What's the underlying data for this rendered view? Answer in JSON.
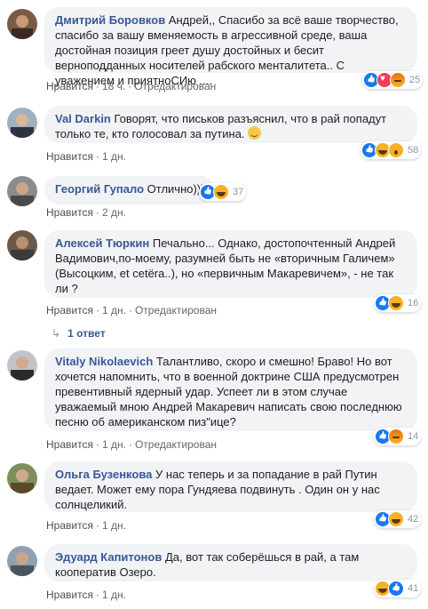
{
  "comments": [
    {
      "author": "Дмитрий Боровков",
      "text": "Андрей,, Спасибо за всё ваше творчество, спасибо за вашу вменяемость в агрессивной среде, ваша достойная позиция греет душу достойных и бесит верноподданных носителей рабского менталитета.. С уважением и приятноСИю ....",
      "like": "Нравится",
      "time": "18 ч.",
      "edited": "Отредактирован",
      "reactions": [
        "like",
        "love",
        "angry"
      ],
      "count": "25"
    },
    {
      "author": "Val Darkin",
      "text": "Говорят, что письков разъяснил, что в рай попадут только те, кто голосовал за путина.",
      "like": "Нравится",
      "time": "1 дн.",
      "edited": "",
      "reactions": [
        "like",
        "haha",
        "wow"
      ],
      "count": "58"
    },
    {
      "author": "Георгий Гупало",
      "text": "Отлично)))",
      "like": "Нравится",
      "time": "2 дн.",
      "edited": "",
      "reactions": [
        "like",
        "haha"
      ],
      "count": "37"
    },
    {
      "author": "Алексей Тюркин",
      "text": "Печально... Однако, достопочтенный Андрей Вадимович,по-моему, разумней быть не «вторичным Галичем» (Высоцким, et cetëra..), но «первичным Макаревичем», - не так ли ?",
      "like": "Нравится",
      "time": "1 дн.",
      "edited": "Отредактирован",
      "reactions": [
        "like",
        "haha"
      ],
      "count": "16",
      "replies": "1 ответ"
    },
    {
      "author": "Vitaly Nikolaevich",
      "text": "Талантливо, скоро и смешно! Браво! Но вот хочется напомнить, что в военной доктрине США предусмотрен превентивный ядерный удар. Успеет ли в этом случае уважаемый мною Андрей Макаревич написать свою последнюю песню об американском пиз\"ице?",
      "like": "Нравится",
      "time": "1 дн.",
      "edited": "Отредактирован",
      "reactions": [
        "like",
        "angry"
      ],
      "count": "14"
    },
    {
      "author": "Ольга Бузенкова",
      "text": "У нас теперь и за попадание в рай Путин ведает. Может ему пора Гундяева подвинуть . Один он у нас солнцеликий.",
      "like": "Нравится",
      "time": "1 дн.",
      "edited": "",
      "reactions": [
        "like",
        "haha"
      ],
      "count": "42"
    },
    {
      "author": "Эдуард Капитонов",
      "text": "Да, вот так соберёшься в рай, а там кооператив Озеро.",
      "like": "Нравится",
      "time": "1 дн.",
      "edited": "",
      "reactions": [
        "haha",
        "like"
      ],
      "count": "41"
    }
  ]
}
